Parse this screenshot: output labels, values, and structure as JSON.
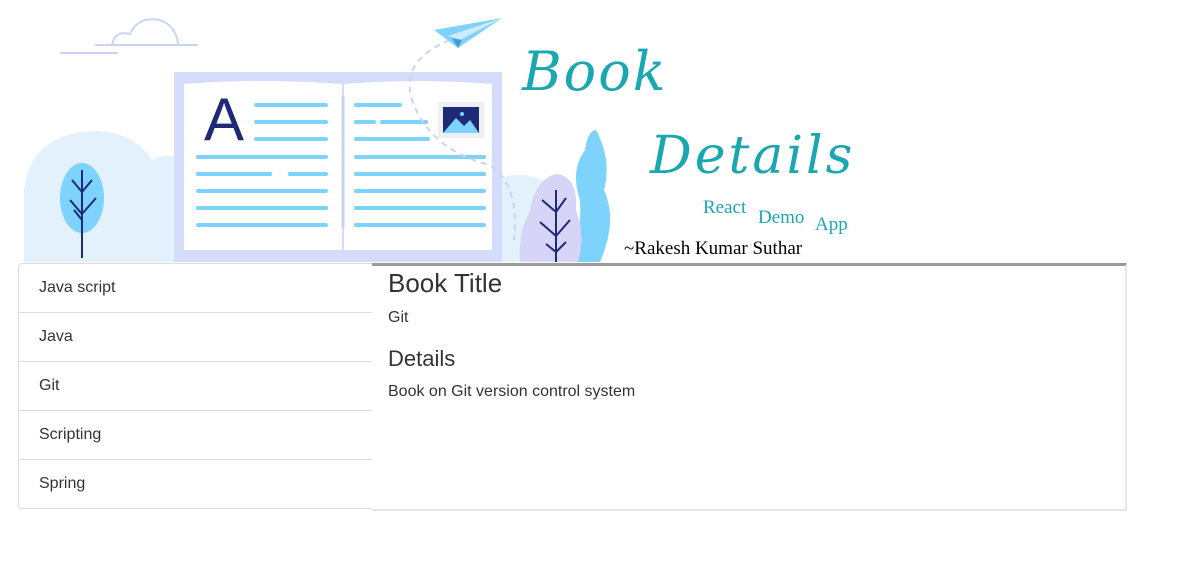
{
  "header": {
    "title_word_1": "Book",
    "title_word_2": "Details",
    "subtitle_words": [
      "React",
      "Demo",
      "App"
    ],
    "author": "~Rakesh Kumar Suthar",
    "illustration_letter": "A"
  },
  "book_list": {
    "items": [
      "Java script",
      "Java",
      "Git",
      "Scripting",
      "Spring"
    ]
  },
  "detail_panel": {
    "title_heading": "Book Title",
    "title_value": "Git",
    "details_heading": "Details",
    "details_value": "Book on Git version control system"
  },
  "colors": {
    "accent_teal": "#1aa7b0",
    "illustration_light_blue": "#7dd3fc",
    "illustration_navy": "#1e2a78",
    "book_frame": "#d5dcfb"
  }
}
